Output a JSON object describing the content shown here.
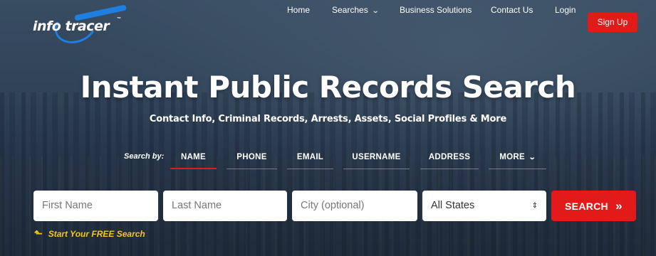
{
  "brand": {
    "logo_left": "info",
    "logo_right": "tracer",
    "trademark": "™"
  },
  "nav": {
    "items": [
      {
        "label": "Home"
      },
      {
        "label": "Searches"
      },
      {
        "label": "Business Solutions"
      },
      {
        "label": "Contact Us"
      },
      {
        "label": "Login"
      }
    ],
    "signup_label": "Sign Up"
  },
  "hero": {
    "title": "Instant Public Records Search",
    "subtitle": "Contact Info, Criminal Records, Arrests, Assets, Social Profiles & More"
  },
  "search": {
    "search_by_label": "Search by:",
    "tabs": [
      {
        "label": "NAME",
        "active": true
      },
      {
        "label": "PHONE"
      },
      {
        "label": "EMAIL"
      },
      {
        "label": "USERNAME"
      },
      {
        "label": "ADDRESS"
      },
      {
        "label": "MORE"
      }
    ],
    "first_name_placeholder": "First Name",
    "last_name_placeholder": "Last Name",
    "city_placeholder": "City (optional)",
    "state_selected": "All States",
    "button_label": "SEARCH",
    "button_icon": "»",
    "free_search_label": "Start Your FREE Search"
  },
  "colors": {
    "accent_red": "#e21a1a",
    "logo_blue": "#1e7fe0",
    "free_yellow": "#f5c518"
  }
}
